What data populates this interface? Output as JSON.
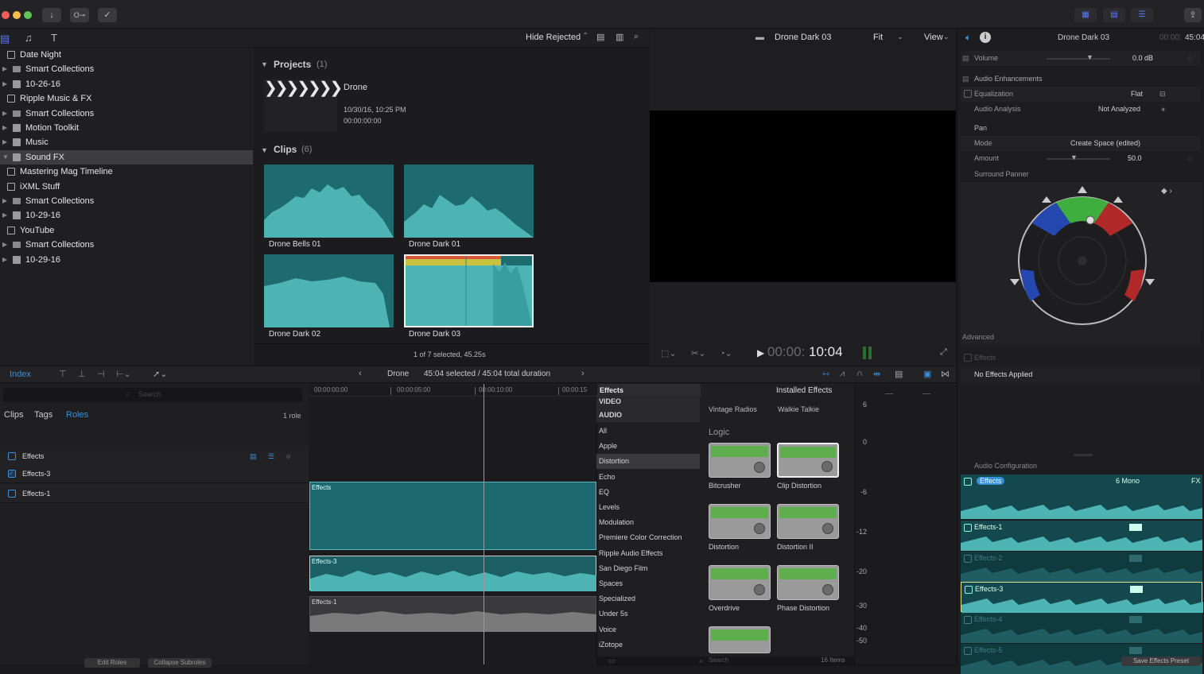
{
  "titlebar": {
    "icons": [
      "download-icon",
      "key-icon",
      "checkmark-icon"
    ]
  },
  "browser_toolbar": {
    "hide_rejected": "Hide Rejected"
  },
  "sidebar": {
    "items": [
      {
        "label": "Date Night",
        "type": "library",
        "indent": 0
      },
      {
        "label": "Smart Collections",
        "type": "folder",
        "indent": 1
      },
      {
        "label": "10-26-16",
        "type": "event",
        "indent": 1
      },
      {
        "label": "Ripple Music & FX",
        "type": "library",
        "indent": 0
      },
      {
        "label": "Smart Collections",
        "type": "folder",
        "indent": 1
      },
      {
        "label": "Motion Toolkit",
        "type": "event",
        "indent": 1
      },
      {
        "label": "Music",
        "type": "event",
        "indent": 1
      },
      {
        "label": "Sound FX",
        "type": "event",
        "indent": 1,
        "selected": true
      },
      {
        "label": "Mastering Mag Timeline",
        "type": "library",
        "indent": 0
      },
      {
        "label": "iXML Stuff",
        "type": "library",
        "indent": 0
      },
      {
        "label": "Smart Collections",
        "type": "folder",
        "indent": 1
      },
      {
        "label": "10-29-16",
        "type": "event",
        "indent": 1
      },
      {
        "label": "YouTube",
        "type": "library",
        "indent": 0
      },
      {
        "label": "Smart Collections",
        "type": "folder",
        "indent": 1
      },
      {
        "label": "10-29-16",
        "type": "event",
        "indent": 1
      }
    ]
  },
  "browser": {
    "projects_label": "Projects",
    "projects_count": "(1)",
    "project": {
      "name": "Drone",
      "date": "10/30/16, 10:25 PM",
      "duration": "00:00:00:00"
    },
    "clips_label": "Clips",
    "clips_count": "(6)",
    "clips": [
      {
        "name": "Drone Bells 01"
      },
      {
        "name": "Drone Dark 01"
      },
      {
        "name": "Drone Dark 02"
      },
      {
        "name": "Drone Dark 03",
        "selected": true
      }
    ],
    "status": "1 of 7 selected, 45.25s"
  },
  "viewer": {
    "clip_name": "Drone Dark 03",
    "fit": "Fit",
    "view": "View",
    "timecode_dim": "00:00:",
    "timecode": "10:04"
  },
  "inspector": {
    "title": "Drone Dark 03",
    "timecode_dim": "00:00:",
    "timecode": "45:04",
    "volume_label": "Volume",
    "volume_value": "0.0 dB",
    "enhancements": "Audio Enhancements",
    "equalization": "Equalization",
    "equalization_value": "Flat",
    "analysis": "Audio Analysis",
    "analysis_value": "Not Analyzed",
    "pan": "Pan",
    "mode": "Mode",
    "mode_value": "Create Space (edited)",
    "amount": "Amount",
    "amount_value": "50.0",
    "surround": "Surround Panner",
    "advanced": "Advanced",
    "effects": "Effects",
    "no_effects": "No Effects Applied",
    "audio_config": "Audio Configuration",
    "config_rows": [
      {
        "label": "Effects",
        "right": "6 Mono",
        "active": true
      },
      {
        "label": "Effects-1",
        "active": true
      },
      {
        "label": "Effects-2",
        "active": false
      },
      {
        "label": "Effects-3",
        "active": true,
        "selected": true
      },
      {
        "label": "Effects-4",
        "active": false
      },
      {
        "label": "Effects-5",
        "active": false
      }
    ]
  },
  "timeline_bar": {
    "index": "Index",
    "project": "Drone",
    "duration": "45:04 selected / 45:04 total duration"
  },
  "index": {
    "search_placeholder": "Search",
    "tabs": [
      "Clips",
      "Tags",
      "Roles"
    ],
    "role_count": "1 role",
    "roles": [
      {
        "label": "Effects",
        "parent": true
      },
      {
        "label": "Effects-3",
        "checked": true
      },
      {
        "label": "Effects-1",
        "checked": false
      }
    ],
    "edit_roles": "Edit Roles",
    "collapse_subroles": "Collapse Subroles"
  },
  "timeline": {
    "ruler": [
      "00:00:00:00",
      "00:00:05:00",
      "00:00:10:00",
      "00:00:15"
    ],
    "clips": [
      "Effects",
      "Effects-3",
      "Effects-1"
    ]
  },
  "effects_browser": {
    "title": "Effects",
    "installed": "Installed Effects",
    "categories": [
      "VIDEO",
      "AUDIO",
      "All",
      "Apple",
      "Distortion",
      "Echo",
      "EQ",
      "Levels",
      "Modulation",
      "Premiere Color Correction",
      "Ripple Audio Effects",
      "San Diego Film",
      "Spaces",
      "Specialized",
      "Under 5s",
      "Voice",
      "iZotope"
    ],
    "selected_category": "Distortion",
    "top_items": [
      "Vintage Radios",
      "Walkie Talkie"
    ],
    "group": "Logic",
    "effects": [
      "Bitcrusher",
      "Clip Distortion",
      "Distortion",
      "Distortion II",
      "Overdrive",
      "Phase Distortion"
    ],
    "search_placeholder": "Search",
    "item_count": "16 Items"
  },
  "meters": {
    "scale": [
      "6",
      "0",
      "-6",
      "-12",
      "-20",
      "-30",
      "-40",
      "-50"
    ]
  },
  "save_preset": "Save Effects Preset",
  "colors": {
    "accent": "#3b8fd8",
    "teal": "#1d6a6f",
    "waveform": "#4db3b3",
    "selection": "#e6e08a"
  }
}
